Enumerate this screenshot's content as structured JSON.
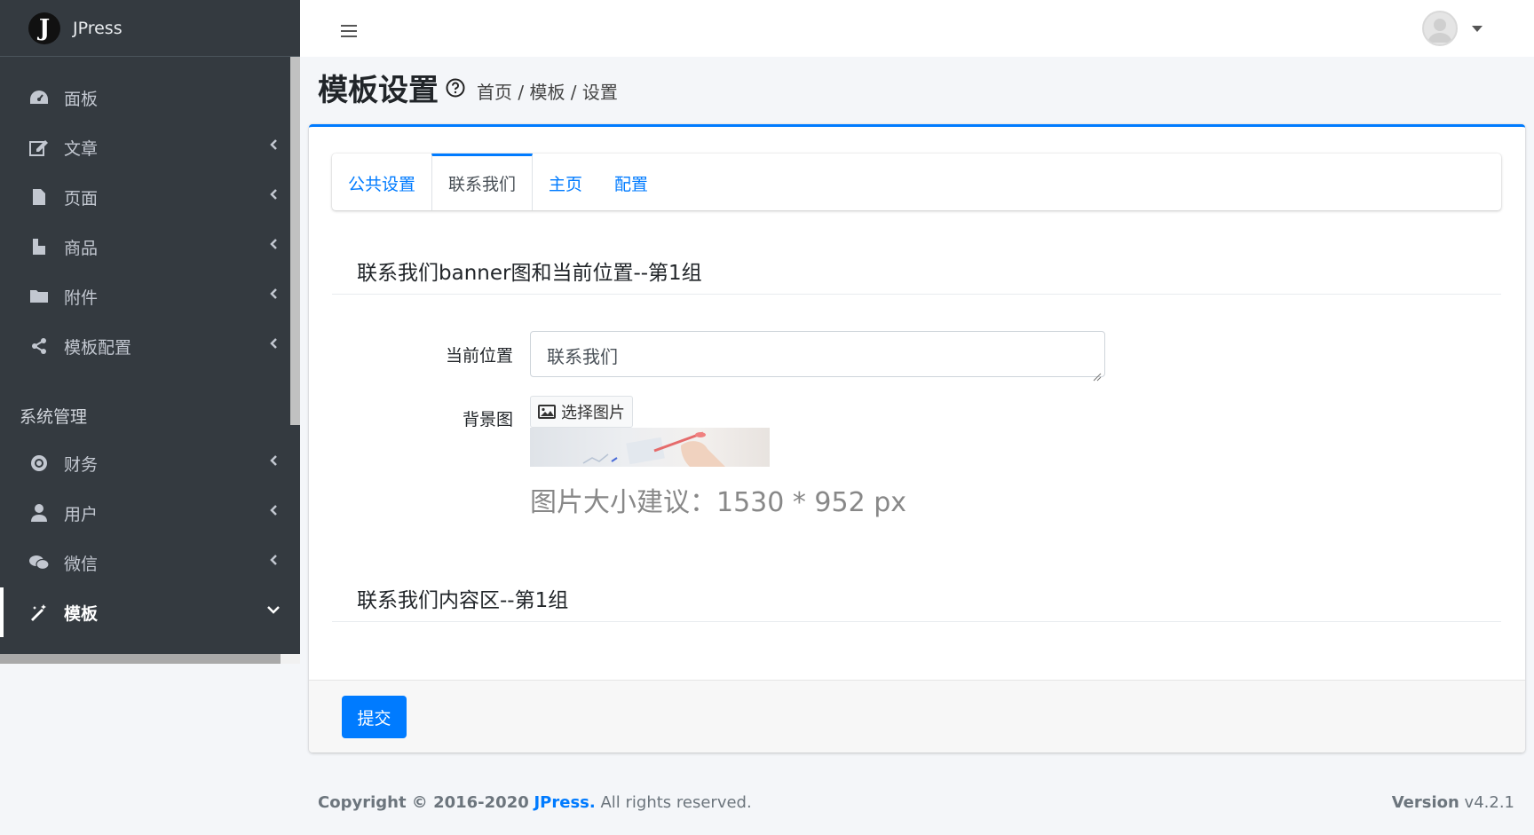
{
  "brand": {
    "name": "JPress",
    "logo_letter": "J"
  },
  "sidebar": {
    "items": [
      {
        "label": "面板",
        "icon": "dashboard-icon"
      },
      {
        "label": "文章",
        "icon": "edit-icon"
      },
      {
        "label": "页面",
        "icon": "file-icon"
      },
      {
        "label": "商品",
        "icon": "product-icon"
      },
      {
        "label": "附件",
        "icon": "folder-icon"
      },
      {
        "label": "模板配置",
        "icon": "share-icon"
      }
    ],
    "section_header": "系统管理",
    "system_items": [
      {
        "label": "财务",
        "icon": "finance-icon"
      },
      {
        "label": "用户",
        "icon": "user-icon"
      },
      {
        "label": "微信",
        "icon": "wechat-icon"
      },
      {
        "label": "模板",
        "icon": "magic-wand-icon",
        "active": true
      }
    ]
  },
  "header": {
    "title": "模板设置",
    "breadcrumb": "首页 / 模板 / 设置"
  },
  "tabs": [
    {
      "label": "公共设置"
    },
    {
      "label": "联系我们",
      "active": true
    },
    {
      "label": "主页"
    },
    {
      "label": "配置"
    }
  ],
  "form": {
    "section1_title": "联系我们banner图和当前位置--第1组",
    "location_label": "当前位置",
    "location_value": "联系我们",
    "background_label": "背景图",
    "pick_image_label": "选择图片",
    "size_hint": "图片大小建议：1530 * 952 px",
    "section2_title": "联系我们内容区--第1组",
    "submit_label": "提交"
  },
  "footer": {
    "copyright_prefix": "Copyright © 2016-2020",
    "brand_link": "JPress.",
    "rights": " All rights reserved.",
    "version_label": "Version",
    "version_value": "v4.2.1"
  },
  "colors": {
    "accent": "#007bff",
    "sidebar_bg": "#343a40"
  }
}
